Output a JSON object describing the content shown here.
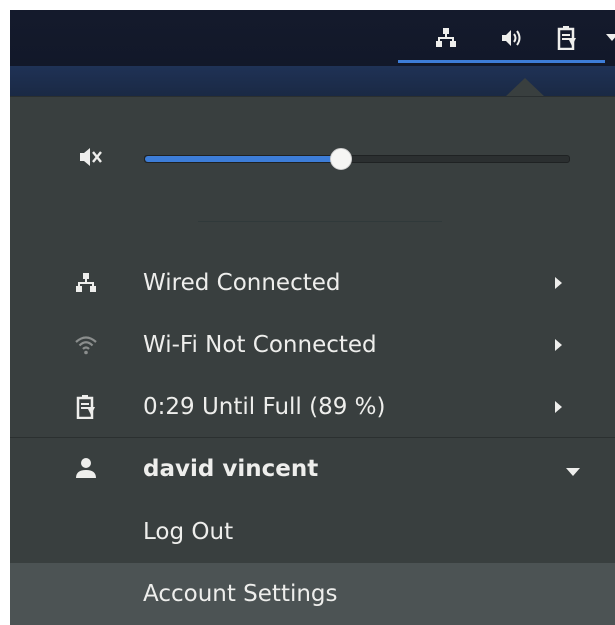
{
  "topbar": {
    "tray_icons": [
      "network-wired-icon",
      "volume-icon",
      "battery-charging-icon",
      "dropdown-arrow-icon"
    ]
  },
  "volume": {
    "icon": "volume-muted-icon",
    "level": 0.46
  },
  "menu_items": {
    "wired": {
      "label": "Wired Connected",
      "icon": "network-wired-icon"
    },
    "wifi": {
      "label": "Wi-Fi Not Connected",
      "icon": "wifi-icon"
    },
    "battery": {
      "label": "0:29 Until Full (89 %)",
      "icon": "battery-charging-icon"
    }
  },
  "user": {
    "name": "david vincent",
    "icon": "user-icon",
    "log_out_label": "Log Out",
    "account_settings_label": "Account Settings"
  },
  "colors": {
    "accent": "#3d7dd8",
    "menu_bg": "#393f3f",
    "hover_bg": "#4c5354",
    "topbar_bg": "#141a2c"
  }
}
